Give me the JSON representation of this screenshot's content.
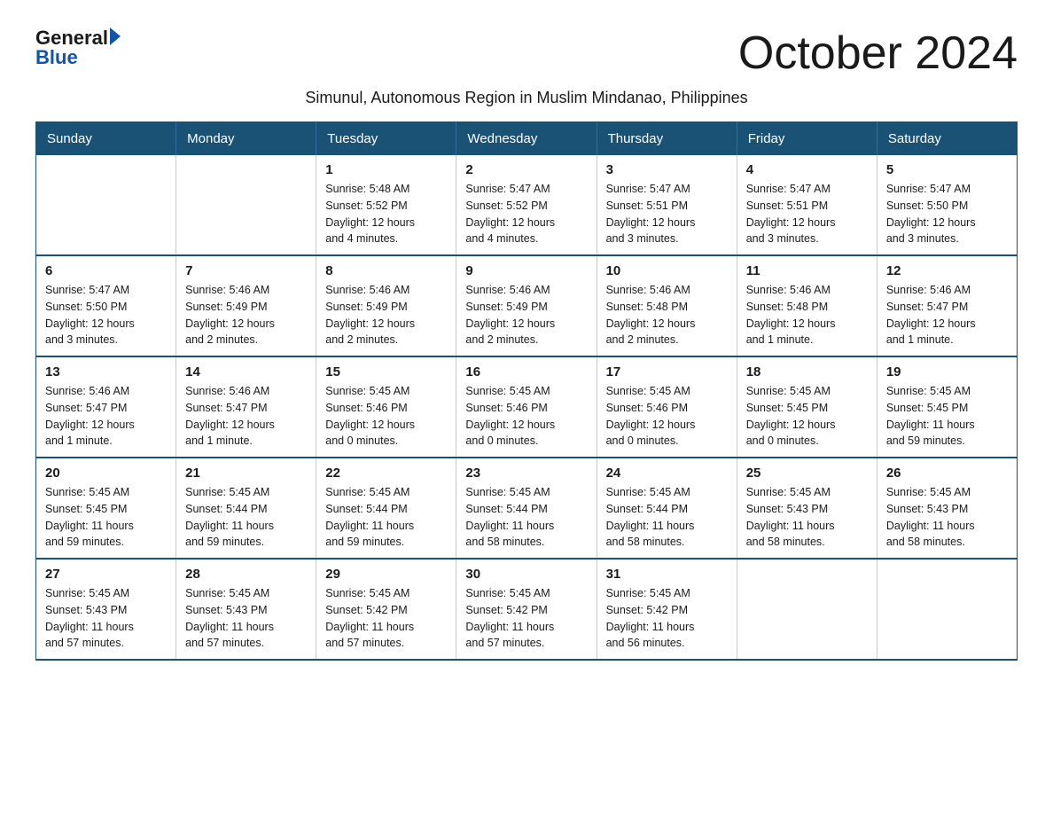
{
  "logo": {
    "general": "General",
    "arrow": "▶",
    "blue": "Blue"
  },
  "title": "October 2024",
  "subtitle": "Simunul, Autonomous Region in Muslim Mindanao, Philippines",
  "weekdays": [
    "Sunday",
    "Monday",
    "Tuesday",
    "Wednesday",
    "Thursday",
    "Friday",
    "Saturday"
  ],
  "weeks": [
    [
      {
        "day": "",
        "info": ""
      },
      {
        "day": "",
        "info": ""
      },
      {
        "day": "1",
        "info": "Sunrise: 5:48 AM\nSunset: 5:52 PM\nDaylight: 12 hours\nand 4 minutes."
      },
      {
        "day": "2",
        "info": "Sunrise: 5:47 AM\nSunset: 5:52 PM\nDaylight: 12 hours\nand 4 minutes."
      },
      {
        "day": "3",
        "info": "Sunrise: 5:47 AM\nSunset: 5:51 PM\nDaylight: 12 hours\nand 3 minutes."
      },
      {
        "day": "4",
        "info": "Sunrise: 5:47 AM\nSunset: 5:51 PM\nDaylight: 12 hours\nand 3 minutes."
      },
      {
        "day": "5",
        "info": "Sunrise: 5:47 AM\nSunset: 5:50 PM\nDaylight: 12 hours\nand 3 minutes."
      }
    ],
    [
      {
        "day": "6",
        "info": "Sunrise: 5:47 AM\nSunset: 5:50 PM\nDaylight: 12 hours\nand 3 minutes."
      },
      {
        "day": "7",
        "info": "Sunrise: 5:46 AM\nSunset: 5:49 PM\nDaylight: 12 hours\nand 2 minutes."
      },
      {
        "day": "8",
        "info": "Sunrise: 5:46 AM\nSunset: 5:49 PM\nDaylight: 12 hours\nand 2 minutes."
      },
      {
        "day": "9",
        "info": "Sunrise: 5:46 AM\nSunset: 5:49 PM\nDaylight: 12 hours\nand 2 minutes."
      },
      {
        "day": "10",
        "info": "Sunrise: 5:46 AM\nSunset: 5:48 PM\nDaylight: 12 hours\nand 2 minutes."
      },
      {
        "day": "11",
        "info": "Sunrise: 5:46 AM\nSunset: 5:48 PM\nDaylight: 12 hours\nand 1 minute."
      },
      {
        "day": "12",
        "info": "Sunrise: 5:46 AM\nSunset: 5:47 PM\nDaylight: 12 hours\nand 1 minute."
      }
    ],
    [
      {
        "day": "13",
        "info": "Sunrise: 5:46 AM\nSunset: 5:47 PM\nDaylight: 12 hours\nand 1 minute."
      },
      {
        "day": "14",
        "info": "Sunrise: 5:46 AM\nSunset: 5:47 PM\nDaylight: 12 hours\nand 1 minute."
      },
      {
        "day": "15",
        "info": "Sunrise: 5:45 AM\nSunset: 5:46 PM\nDaylight: 12 hours\nand 0 minutes."
      },
      {
        "day": "16",
        "info": "Sunrise: 5:45 AM\nSunset: 5:46 PM\nDaylight: 12 hours\nand 0 minutes."
      },
      {
        "day": "17",
        "info": "Sunrise: 5:45 AM\nSunset: 5:46 PM\nDaylight: 12 hours\nand 0 minutes."
      },
      {
        "day": "18",
        "info": "Sunrise: 5:45 AM\nSunset: 5:45 PM\nDaylight: 12 hours\nand 0 minutes."
      },
      {
        "day": "19",
        "info": "Sunrise: 5:45 AM\nSunset: 5:45 PM\nDaylight: 11 hours\nand 59 minutes."
      }
    ],
    [
      {
        "day": "20",
        "info": "Sunrise: 5:45 AM\nSunset: 5:45 PM\nDaylight: 11 hours\nand 59 minutes."
      },
      {
        "day": "21",
        "info": "Sunrise: 5:45 AM\nSunset: 5:44 PM\nDaylight: 11 hours\nand 59 minutes."
      },
      {
        "day": "22",
        "info": "Sunrise: 5:45 AM\nSunset: 5:44 PM\nDaylight: 11 hours\nand 59 minutes."
      },
      {
        "day": "23",
        "info": "Sunrise: 5:45 AM\nSunset: 5:44 PM\nDaylight: 11 hours\nand 58 minutes."
      },
      {
        "day": "24",
        "info": "Sunrise: 5:45 AM\nSunset: 5:44 PM\nDaylight: 11 hours\nand 58 minutes."
      },
      {
        "day": "25",
        "info": "Sunrise: 5:45 AM\nSunset: 5:43 PM\nDaylight: 11 hours\nand 58 minutes."
      },
      {
        "day": "26",
        "info": "Sunrise: 5:45 AM\nSunset: 5:43 PM\nDaylight: 11 hours\nand 58 minutes."
      }
    ],
    [
      {
        "day": "27",
        "info": "Sunrise: 5:45 AM\nSunset: 5:43 PM\nDaylight: 11 hours\nand 57 minutes."
      },
      {
        "day": "28",
        "info": "Sunrise: 5:45 AM\nSunset: 5:43 PM\nDaylight: 11 hours\nand 57 minutes."
      },
      {
        "day": "29",
        "info": "Sunrise: 5:45 AM\nSunset: 5:42 PM\nDaylight: 11 hours\nand 57 minutes."
      },
      {
        "day": "30",
        "info": "Sunrise: 5:45 AM\nSunset: 5:42 PM\nDaylight: 11 hours\nand 57 minutes."
      },
      {
        "day": "31",
        "info": "Sunrise: 5:45 AM\nSunset: 5:42 PM\nDaylight: 11 hours\nand 56 minutes."
      },
      {
        "day": "",
        "info": ""
      },
      {
        "day": "",
        "info": ""
      }
    ]
  ]
}
